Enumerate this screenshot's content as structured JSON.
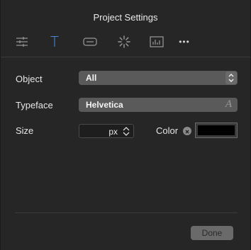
{
  "window": {
    "title": "Project Settings"
  },
  "toolbar": {
    "items": [
      {
        "icon": "sliders-icon",
        "active": false
      },
      {
        "icon": "text-icon",
        "active": true
      },
      {
        "icon": "button-shape-icon",
        "active": false
      },
      {
        "icon": "activity-indicator-icon",
        "active": false
      },
      {
        "icon": "chart-icon",
        "active": false
      },
      {
        "icon": "more-icon",
        "active": false
      }
    ],
    "text_glyph": "T",
    "more_glyph": "•••",
    "active_color": "#4a90e2"
  },
  "form": {
    "object_label": "Object",
    "object_value": "All",
    "typeface_label": "Typeface",
    "typeface_value": "Helvetica",
    "typeface_icon_glyph": "A",
    "size_label": "Size",
    "size_value": "",
    "size_unit": "px",
    "color_label": "Color",
    "color_value": "#000000"
  },
  "footer": {
    "done_label": "Done"
  }
}
